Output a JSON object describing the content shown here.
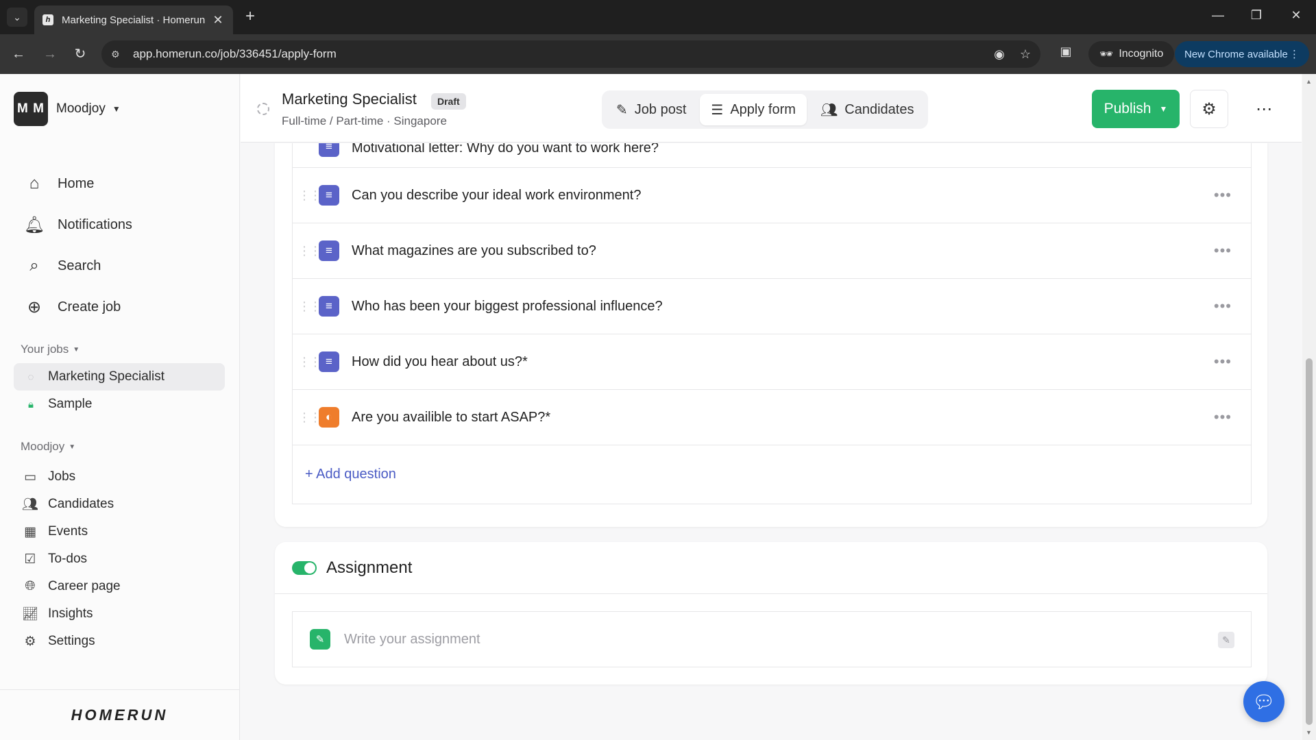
{
  "browser": {
    "tab_title": "Marketing Specialist · Homerun",
    "url": "app.homerun.co/job/336451/apply-form",
    "incognito_label": "Incognito",
    "update_label": "New Chrome available"
  },
  "sidebar": {
    "org_initials": "M M",
    "org_name": "Moodjoy",
    "main_nav": [
      {
        "label": "Home",
        "icon": "home-icon"
      },
      {
        "label": "Notifications",
        "icon": "bell-icon"
      },
      {
        "label": "Search",
        "icon": "search-icon"
      },
      {
        "label": "Create job",
        "icon": "plus-circle-icon"
      }
    ],
    "your_jobs_label": "Your jobs",
    "jobs": [
      {
        "label": "Marketing Specialist",
        "icon": "draft-status-icon"
      },
      {
        "label": "Sample",
        "icon": "lock-icon"
      }
    ],
    "org_section_label": "Moodjoy",
    "org_nav": [
      {
        "label": "Jobs",
        "icon": "briefcase-icon"
      },
      {
        "label": "Candidates",
        "icon": "people-icon"
      },
      {
        "label": "Events",
        "icon": "calendar-icon"
      },
      {
        "label": "To-dos",
        "icon": "checkbox-icon"
      },
      {
        "label": "Career page",
        "icon": "globe-icon"
      },
      {
        "label": "Insights",
        "icon": "chart-icon"
      },
      {
        "label": "Settings",
        "icon": "gear-icon"
      }
    ],
    "brand": "HOMERUN"
  },
  "header": {
    "job_title": "Marketing Specialist",
    "badge": "Draft",
    "meta": "Full-time / Part-time · Singapore",
    "tabs": [
      {
        "label": "Job post",
        "icon": "pencil-icon"
      },
      {
        "label": "Apply form",
        "icon": "list-icon"
      },
      {
        "label": "Candidates",
        "icon": "people-icon"
      }
    ],
    "publish_label": "Publish"
  },
  "questions": {
    "partial_label": "Motivational letter: Why do you want to work here?",
    "items": [
      {
        "label": "Can you describe your ideal work environment?",
        "type": "text"
      },
      {
        "label": "What magazines are you subscribed to?",
        "type": "text"
      },
      {
        "label": "Who has been your biggest professional influence?",
        "type": "text"
      },
      {
        "label": "How did you hear about us?*",
        "type": "text"
      },
      {
        "label": "Are you availible to start ASAP?*",
        "type": "yes-no"
      }
    ],
    "add_label": "+ Add question"
  },
  "assignment": {
    "title": "Assignment",
    "enabled": true,
    "placeholder": "Write your assignment"
  },
  "colors": {
    "accent_green": "#27b46a",
    "text_question_icon": "#5b63c8",
    "yesno_question_icon": "#ef7d2c",
    "link_blue": "#4a5bc4"
  }
}
